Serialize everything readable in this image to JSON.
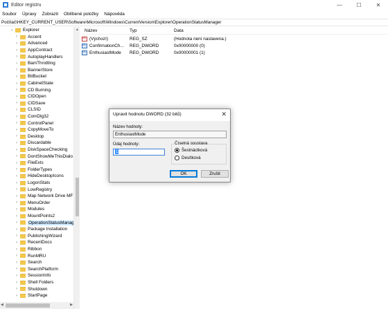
{
  "window": {
    "title": "Editor registru",
    "controls": [
      "—",
      "☐",
      "✕"
    ]
  },
  "menu": [
    "Soubor",
    "Úpravy",
    "Zobrazit",
    "Oblíbené položky",
    "Nápověda"
  ],
  "address": "Počítač\\HKEY_CURRENT_USER\\Software\\Microsoft\\Windows\\CurrentVersion\\Explorer\\OperationStatusManager",
  "tree": {
    "parent": "Explorer",
    "items": [
      "Accent",
      "Advanced",
      "AppContract",
      "AutoplayHandlers",
      "BamThrottling",
      "BannerStore",
      "BitBucket",
      "CabinetState",
      "CD Burning",
      "CIDOpen",
      "CIDSave",
      "CLSID",
      "ComDlg32",
      "ControlPanel",
      "CopyMoveTo",
      "Desktop",
      "Discardable",
      "DiskSpaceChecking",
      "DontShowMeThisDialo",
      "FileExts",
      "FolderTypes",
      "HideDesktopIcons",
      "LogonStats",
      "LowRegistry",
      "Map Network Drive MF",
      "MenuOrder",
      "Modules",
      "MountPoints2",
      "OperationStatusManag",
      "Package Installation",
      "PublishingWizard",
      "RecentDocs",
      "Ribbon",
      "RunMRU",
      "Search",
      "SearchPlatform",
      "SessionInfo",
      "Shell Folders",
      "Shutdown",
      "StartPage"
    ],
    "selected_index": 28
  },
  "list": {
    "headers": [
      "Název",
      "Typ",
      "Data"
    ],
    "rows": [
      {
        "icon": "ab",
        "name": "(Výchozí)",
        "type": "REG_SZ",
        "data": "(Hodnota není nastavena.)"
      },
      {
        "icon": "bin",
        "name": "ConfirmationCh...",
        "type": "REG_DWORD",
        "data": "0x00000000 (0)"
      },
      {
        "icon": "bin",
        "name": "EnthusiastMode",
        "type": "REG_DWORD",
        "data": "0x00000001 (1)"
      }
    ]
  },
  "dialog": {
    "title": "Upravit hodnotu DWORD (32 bitů)",
    "name_label": "Název hodnoty:",
    "name_value": "EnthusiastMode",
    "data_label": "Údaj hodnoty:",
    "data_value": "1",
    "base_label": "Číselná soustava",
    "base_options": [
      "Šestnáctková",
      "Desítková"
    ],
    "base_selected": 0,
    "ok_label": "OK",
    "cancel_label": "Zrušit"
  }
}
